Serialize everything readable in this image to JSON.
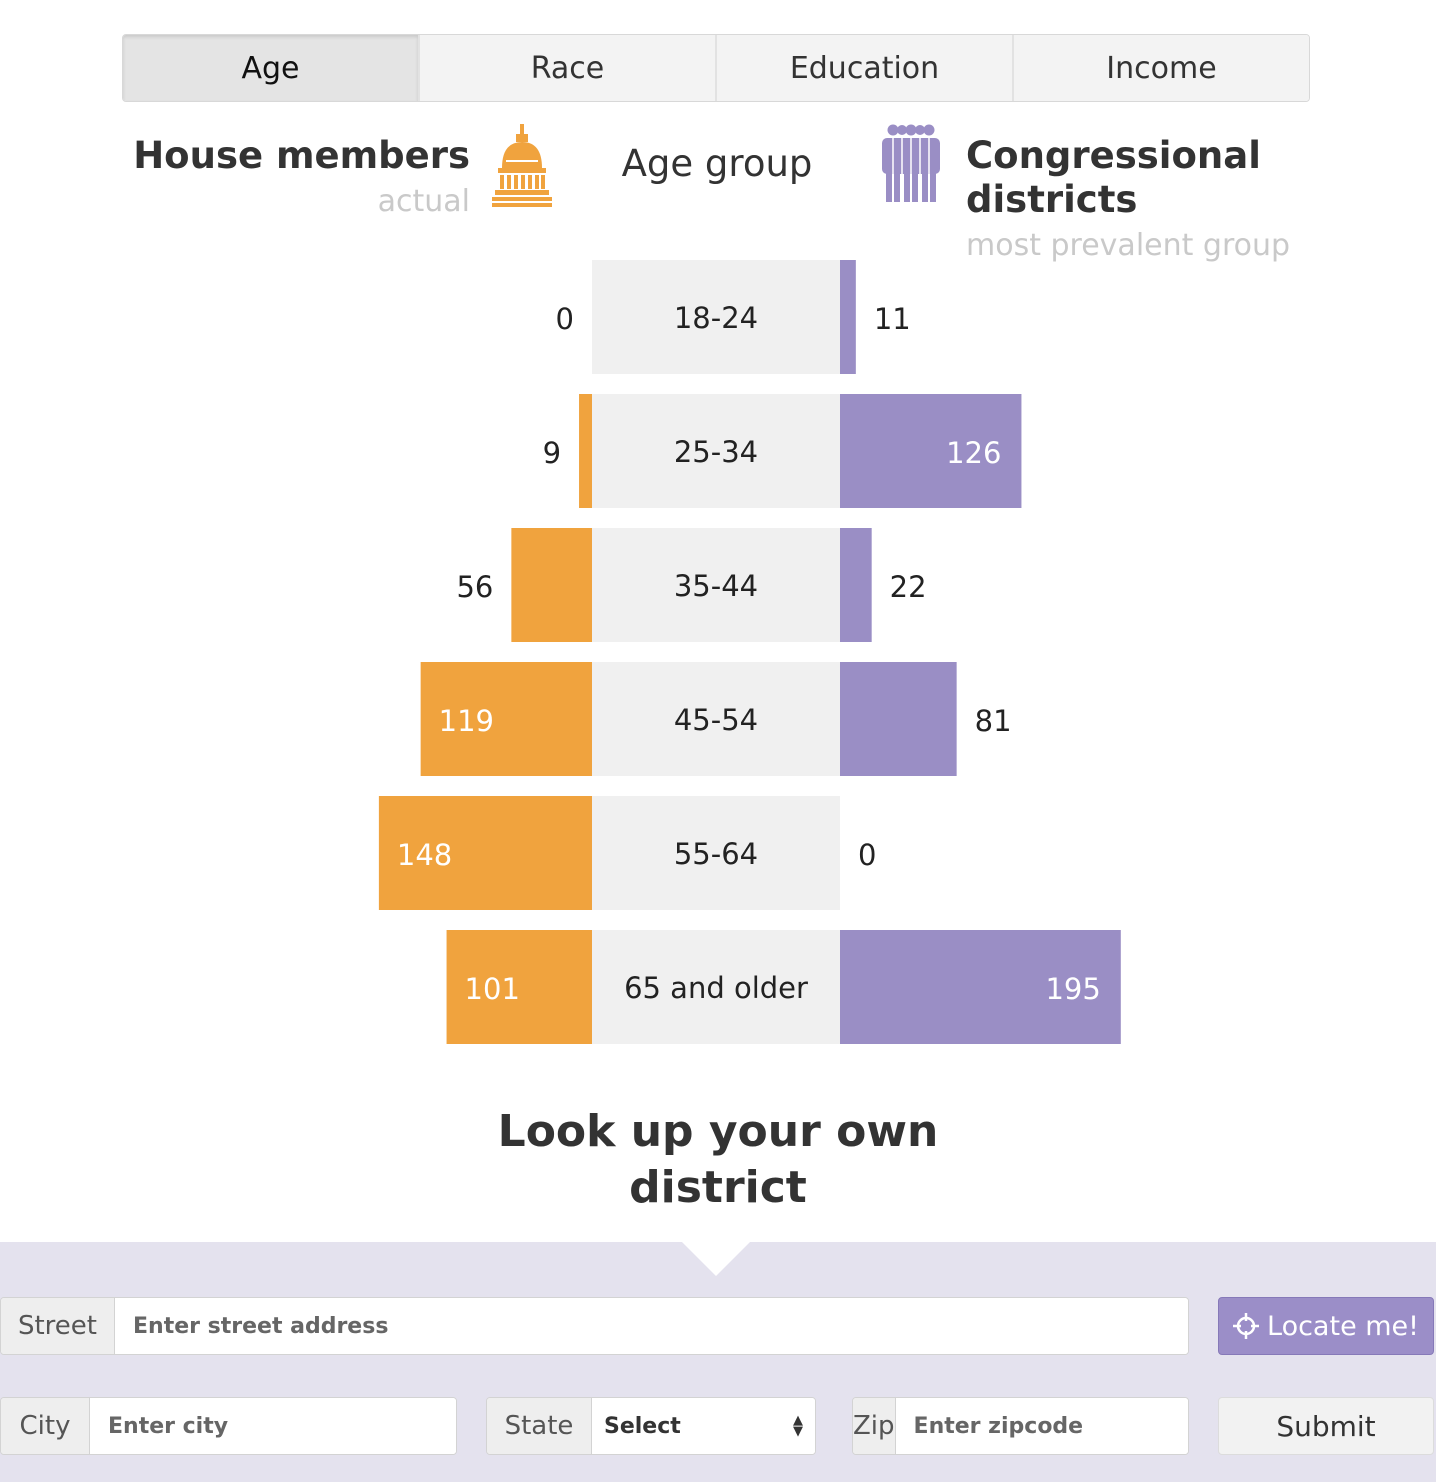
{
  "tabs": [
    {
      "label": "Age",
      "active": true
    },
    {
      "label": "Race",
      "active": false
    },
    {
      "label": "Education",
      "active": false
    },
    {
      "label": "Income",
      "active": false
    }
  ],
  "header": {
    "left_title": "House members",
    "left_sub": "actual",
    "middle_title": "Age group",
    "right_title": "Congressional districts",
    "right_sub": "most prevalent group",
    "left_icon": "capitol-icon",
    "right_icon": "people-group-icon"
  },
  "chart_data": {
    "type": "bar",
    "orientation": "diverging-horizontal",
    "categories": [
      "18-24",
      "25-34",
      "35-44",
      "45-54",
      "55-64",
      "65 and older"
    ],
    "series": [
      {
        "name": "House members",
        "values": [
          0,
          9,
          56,
          119,
          148,
          101
        ],
        "color": "#f0a33e"
      },
      {
        "name": "Congressional districts",
        "values": [
          11,
          126,
          22,
          81,
          0,
          195
        ],
        "color": "#9a8ec5"
      }
    ]
  },
  "colors": {
    "house": "#f0a33e",
    "districts": "#9a8ec5",
    "category_bg": "#f0f0f0",
    "header_sub": "#c9c9c9"
  },
  "lookup": {
    "title_line1": "Look up your own",
    "title_line2": "district",
    "street_label": "Street",
    "street_placeholder": "Enter street address",
    "locate_label": "Locate me!",
    "locate_icon": "crosshair-icon",
    "city_label": "City",
    "city_placeholder": "Enter city",
    "state_label": "State",
    "state_value": "Select",
    "zip_label": "Zip",
    "zip_placeholder": "Enter zipcode",
    "submit_label": "Submit"
  }
}
